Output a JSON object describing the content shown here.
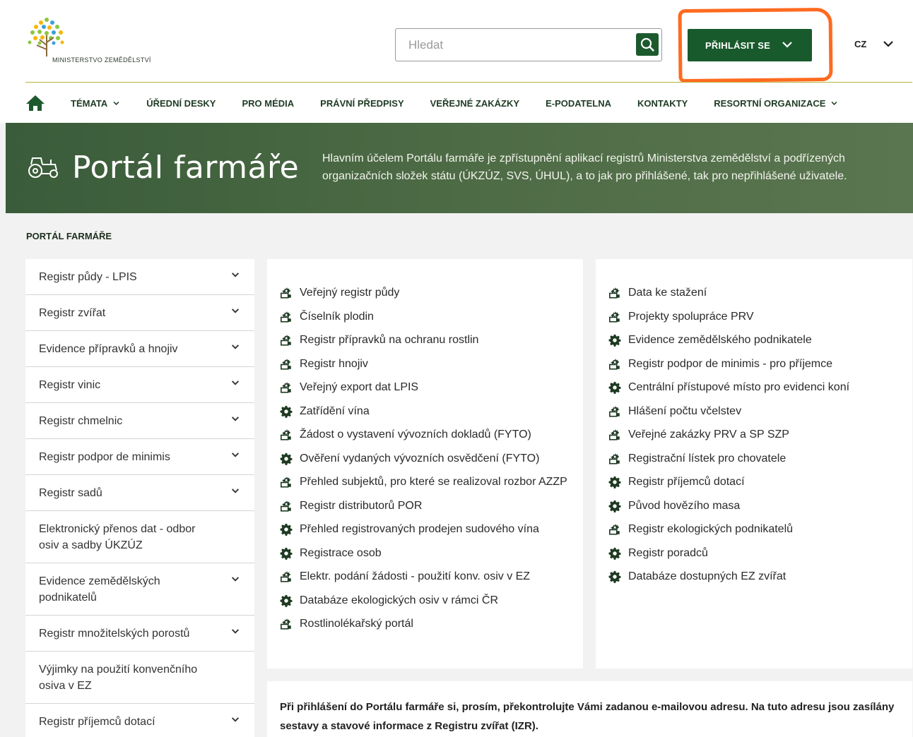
{
  "header": {
    "logo_text": "Ministerstvo zemědělství",
    "search_placeholder": "Hledat",
    "login_label": "PŘIHLÁSIT SE",
    "language": "CZ"
  },
  "nav": {
    "items": [
      {
        "label": "TÉMATA",
        "dropdown": true
      },
      {
        "label": "ÚŘEDNÍ DESKY",
        "dropdown": false
      },
      {
        "label": "PRO MÉDIA",
        "dropdown": false
      },
      {
        "label": "PRÁVNÍ PŘEDPISY",
        "dropdown": false
      },
      {
        "label": "VEŘEJNÉ ZAKÁZKY",
        "dropdown": false
      },
      {
        "label": "E-PODATELNA",
        "dropdown": false
      },
      {
        "label": "KONTAKTY",
        "dropdown": false
      },
      {
        "label": "RESORTNÍ ORGANIZACE",
        "dropdown": true
      }
    ]
  },
  "banner": {
    "title": "Portál farmáře",
    "description": "Hlavním účelem Portálu farmáře je zpřístupnění aplikací registrů Ministerstva zemědělství a podřízených organizačních složek státu (ÚKZÚZ, SVS, ÚHUL), a to jak pro přihlášené, tak pro nepřihlášené uživatele."
  },
  "breadcrumb": "PORTÁL FARMÁŘE",
  "sidebar": {
    "items": [
      {
        "label": "Registr půdy - LPIS",
        "expandable": true
      },
      {
        "label": "Registr zvířat",
        "expandable": true
      },
      {
        "label": "Evidence přípravků a hnojiv",
        "expandable": true
      },
      {
        "label": "Registr vinic",
        "expandable": true
      },
      {
        "label": "Registr chmelnic",
        "expandable": true
      },
      {
        "label": "Registr podpor de minimis",
        "expandable": true
      },
      {
        "label": "Registr sadů",
        "expandable": true
      },
      {
        "label": "Elektronický přenos dat - odbor osiv a sadby ÚKZÚZ",
        "expandable": false
      },
      {
        "label": "Evidence zemědělských podnikatelů",
        "expandable": true
      },
      {
        "label": "Registr množitelských porostů",
        "expandable": true
      },
      {
        "label": "Výjimky na použití konvenčního osiva v EZ",
        "expandable": false
      },
      {
        "label": "Registr příjemců dotací",
        "expandable": true
      }
    ]
  },
  "apps_left": [
    {
      "label": "Veřejný registr půdy",
      "icon": "public-app-icon"
    },
    {
      "label": "Číselník plodin",
      "icon": "public-app-icon"
    },
    {
      "label": "Registr přípravků na ochranu rostlin",
      "icon": "public-app-icon"
    },
    {
      "label": "Registr hnojiv",
      "icon": "public-app-icon"
    },
    {
      "label": "Veřejný export dat LPIS",
      "icon": "public-app-icon"
    },
    {
      "label": "Zatřídění vína",
      "icon": "gear-icon"
    },
    {
      "label": "Žádost o vystavení vývozních dokladů (FYTO)",
      "icon": "public-app-icon"
    },
    {
      "label": "Ověření vydaných vývozních osvědčení (FYTO)",
      "icon": "gear-icon"
    },
    {
      "label": "Přehled subjektů, pro které se realizoval rozbor AZZP",
      "icon": "public-app-icon"
    },
    {
      "label": "Registr distributorů POR",
      "icon": "public-app-icon"
    },
    {
      "label": "Přehled registrovaných prodejen sudového vína",
      "icon": "gear-icon"
    },
    {
      "label": "Registrace osob",
      "icon": "gear-icon"
    },
    {
      "label": "Elektr. podání žádosti - použití konv. osiv v EZ",
      "icon": "public-app-icon"
    },
    {
      "label": "Databáze ekologických osiv v rámci ČR",
      "icon": "gear-icon"
    },
    {
      "label": "Rostlinolékařský portál",
      "icon": "public-app-icon"
    }
  ],
  "apps_right": [
    {
      "label": "Data ke stažení",
      "icon": "public-app-icon"
    },
    {
      "label": "Projekty spolupráce PRV",
      "icon": "public-app-icon"
    },
    {
      "label": "Evidence zemědělského podnikatele",
      "icon": "gear-icon"
    },
    {
      "label": "Registr podpor de minimis - pro příjemce",
      "icon": "public-app-icon"
    },
    {
      "label": "Centrální přístupové místo pro evidenci koní",
      "icon": "gear-icon"
    },
    {
      "label": "Hlášení počtu včelstev",
      "icon": "public-app-icon"
    },
    {
      "label": "Veřejné zakázky PRV a SP SZP",
      "icon": "public-app-icon"
    },
    {
      "label": "Registrační lístek pro chovatele",
      "icon": "public-app-icon"
    },
    {
      "label": "Registr příjemců dotací",
      "icon": "gear-icon"
    },
    {
      "label": "Původ hovězího masa",
      "icon": "gear-icon"
    },
    {
      "label": "Registr ekologických podnikatelů",
      "icon": "public-app-icon"
    },
    {
      "label": "Registr poradců",
      "icon": "gear-icon"
    },
    {
      "label": "Databáze dostupných EZ zvířat",
      "icon": "gear-icon"
    }
  ],
  "notice": "Při přihlášení do Portálu farmáře si, prosím, překontrolujte Vámi zadanou e-mailovou adresu. Na tuto adresu jsou zasílány sestavy a stavové informace z Registru zvířat (IZR).",
  "colors": {
    "brand_green": "#195a2c",
    "banner_green": "#4d6b45",
    "highlight_orange": "#ff6a1f"
  }
}
